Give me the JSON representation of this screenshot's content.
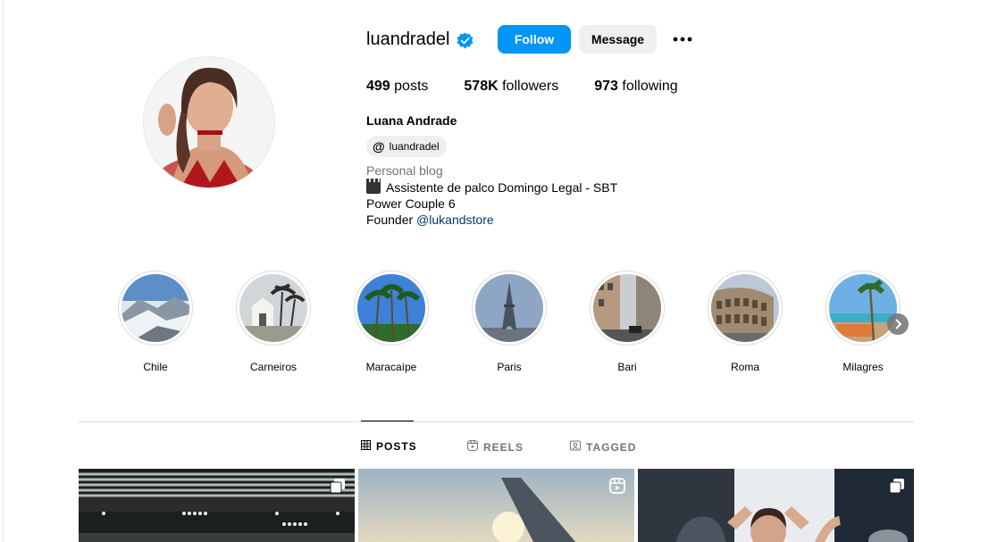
{
  "profile": {
    "username": "luandradel",
    "follow_label": "Follow",
    "message_label": "Message",
    "stats": [
      {
        "count": "499",
        "label": "posts"
      },
      {
        "count": "578K",
        "label": "followers"
      },
      {
        "count": "973",
        "label": "following"
      }
    ],
    "full_name": "Luana Andrade",
    "threads_handle": "luandradel",
    "category": "Personal blog",
    "bio_line1": "Assistente de palco Domingo Legal - SBT",
    "bio_line2": "Power Couple 6",
    "bio_line3_prefix": "Founder ",
    "bio_mention": "@lukandstore"
  },
  "highlights": [
    {
      "name": "Chile"
    },
    {
      "name": "Carneiros"
    },
    {
      "name": "Maracaípe"
    },
    {
      "name": "Paris"
    },
    {
      "name": "Bari"
    },
    {
      "name": "Roma"
    },
    {
      "name": "Milagres"
    }
  ],
  "tabs": [
    {
      "label": "POSTS",
      "icon": "grid-icon",
      "active": true
    },
    {
      "label": "REELS",
      "icon": "reels-icon",
      "active": false
    },
    {
      "label": "TAGGED",
      "icon": "tagged-icon",
      "active": false
    }
  ],
  "colors": {
    "primary_button": "#0095f6",
    "secondary_button": "#efefef",
    "verified": "#0095f6",
    "link": "#00376b",
    "muted": "#737373"
  }
}
